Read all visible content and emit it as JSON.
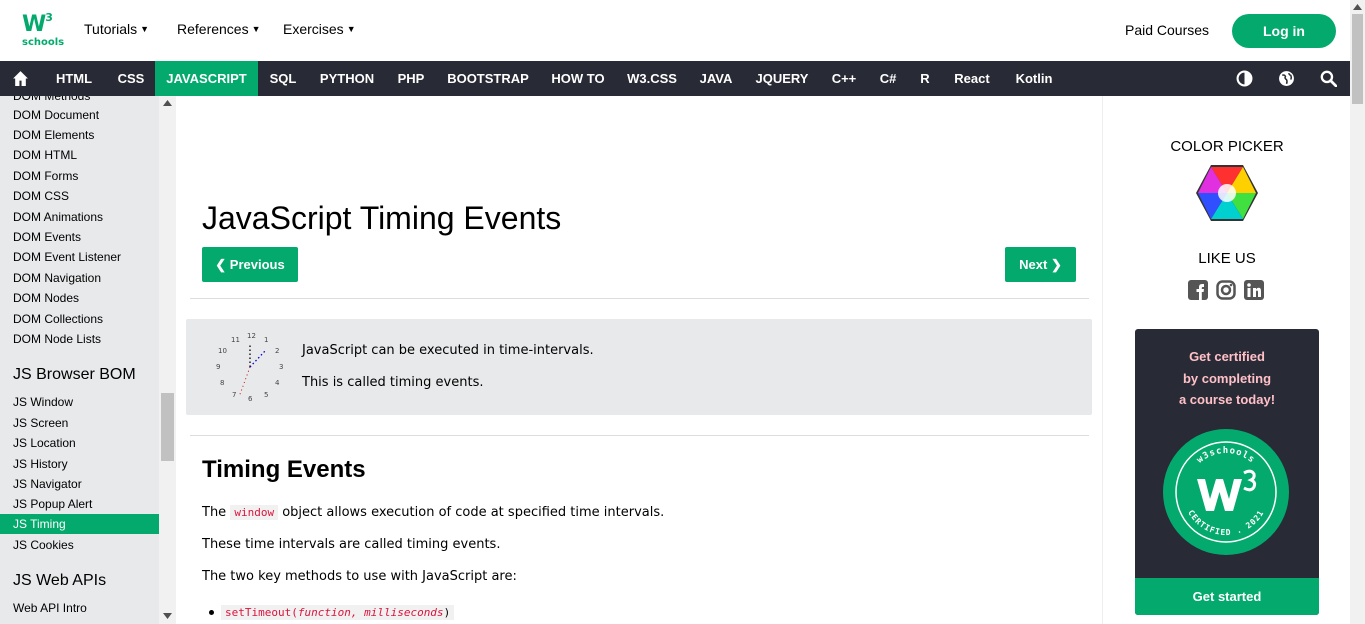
{
  "logo": {
    "main": "W",
    "sup": "3",
    "sub": "schools"
  },
  "topnav": {
    "tutorials": "Tutorials",
    "references": "References",
    "exercises": "Exercises",
    "paid_courses": "Paid Courses",
    "login": "Log in"
  },
  "mainnav": {
    "items": [
      "HTML",
      "CSS",
      "JAVASCRIPT",
      "SQL",
      "PYTHON",
      "PHP",
      "BOOTSTRAP",
      "HOW TO",
      "W3.CSS",
      "JAVA",
      "JQUERY",
      "C++",
      "C#",
      "R",
      "React",
      "Kotlin"
    ],
    "active": "JAVASCRIPT"
  },
  "sidebar": {
    "partial_top": "DOM Methods",
    "dom_links": [
      "DOM Document",
      "DOM Elements",
      "DOM HTML",
      "DOM Forms",
      "DOM CSS",
      "DOM Animations",
      "DOM Events",
      "DOM Event Listener",
      "DOM Navigation",
      "DOM Nodes",
      "DOM Collections",
      "DOM Node Lists"
    ],
    "bom_heading": "JS Browser BOM",
    "bom_links": [
      "JS Window",
      "JS Screen",
      "JS Location",
      "JS History",
      "JS Navigator",
      "JS Popup Alert",
      "JS Timing",
      "JS Cookies"
    ],
    "active": "JS Timing",
    "webapi_heading": "JS Web APIs",
    "webapi_links": [
      "Web API Intro"
    ]
  },
  "main": {
    "title": "JavaScript Timing Events",
    "prev": "❮ Previous",
    "next": "Next ❯",
    "note_line1": "JavaScript can be executed in time-intervals.",
    "note_line2": "This is called timing events.",
    "clock_numbers": [
      "12",
      "1",
      "2",
      "3",
      "4",
      "5",
      "6",
      "7",
      "8",
      "9",
      "10",
      "11"
    ],
    "h2": "Timing Events",
    "p1_before": "The",
    "p1_code": "window",
    "p1_after": "object allows execution of code at specified time intervals.",
    "p2": "These time intervals are called timing events.",
    "p3": "The two key methods to use with JavaScript are:",
    "li1_code": "setTimeout(",
    "li1_args": "function, milliseconds",
    "li1_close": ")"
  },
  "right": {
    "color_picker": "COLOR PICKER",
    "like_us": "LIKE US",
    "cert_line1": "Get certified",
    "cert_line2": "by completing",
    "cert_line3": "a course today!",
    "badge_top": "w3schools",
    "badge_bottom": "CERTIFIED . 2021",
    "get_started": "Get started"
  },
  "colors": {
    "accent": "#04AA6D",
    "nav_dark": "#282A35",
    "sidebar_bg": "#E7E9EB",
    "code_red": "#DC143C",
    "cert_text": "#FFC0C7"
  }
}
